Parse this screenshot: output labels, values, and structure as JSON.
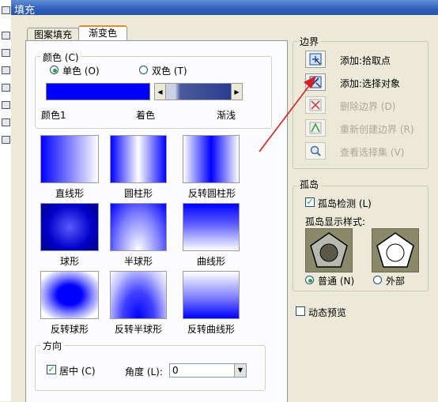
{
  "window": {
    "title": "填充"
  },
  "tabs": [
    {
      "label": "图案填充"
    },
    {
      "label": "渐变色"
    }
  ],
  "color_group": {
    "label": "颜色 (C)",
    "radio_single": "单色 (O)",
    "radio_double": "双色 (T)",
    "selected": "单色",
    "color1": "#0000ff",
    "label_color1": "颜色1",
    "label_tint": "着色",
    "label_shade": "渐浅",
    "scroll_left": "◀",
    "scroll_right": "▶"
  },
  "patterns": [
    {
      "label": "直线形",
      "style": "linear"
    },
    {
      "label": "圆柱形",
      "style": "cylinder"
    },
    {
      "label": "反转圆柱形",
      "style": "invcylinder"
    },
    {
      "label": "球形",
      "style": "spherical"
    },
    {
      "label": "半球形",
      "style": "hemispherical"
    },
    {
      "label": "曲线形",
      "style": "curved"
    },
    {
      "label": "反转球形",
      "style": "invspherical"
    },
    {
      "label": "反转半球形",
      "style": "invhemispherical"
    },
    {
      "label": "反转曲线形",
      "style": "invcurved"
    }
  ],
  "direction": {
    "label": "方向",
    "centered_label": "居中 (C)",
    "centered_checked": true,
    "angle_label": "角度 (L):",
    "angle_value": "0"
  },
  "boundary": {
    "label": "边界",
    "buttons": [
      {
        "label": "添加:拾取点",
        "icon": "pick-points-icon",
        "enabled": true
      },
      {
        "label": "添加:选择对象",
        "icon": "select-objects-icon",
        "enabled": true
      },
      {
        "label": "删除边界 (D)",
        "icon": "remove-boundaries-icon",
        "enabled": false
      },
      {
        "label": "重新创建边界 (R)",
        "icon": "recreate-boundary-icon",
        "enabled": false
      },
      {
        "label": "查看选择集 (V)",
        "icon": "view-selections-icon",
        "enabled": false
      }
    ]
  },
  "island": {
    "label": "孤岛",
    "detect_label": "孤岛检测 (L)",
    "detect_checked": true,
    "style_label": "孤岛显示样式:",
    "normal_label": "普通 (N)",
    "outer_label": "外部",
    "selected": "普通"
  },
  "preview": {
    "label": "动态预览",
    "checked": false
  },
  "colors": {
    "accent_arrow": "#d42020",
    "gradient_blue": "#0000ff",
    "title_blue": "#2f5fb8"
  }
}
